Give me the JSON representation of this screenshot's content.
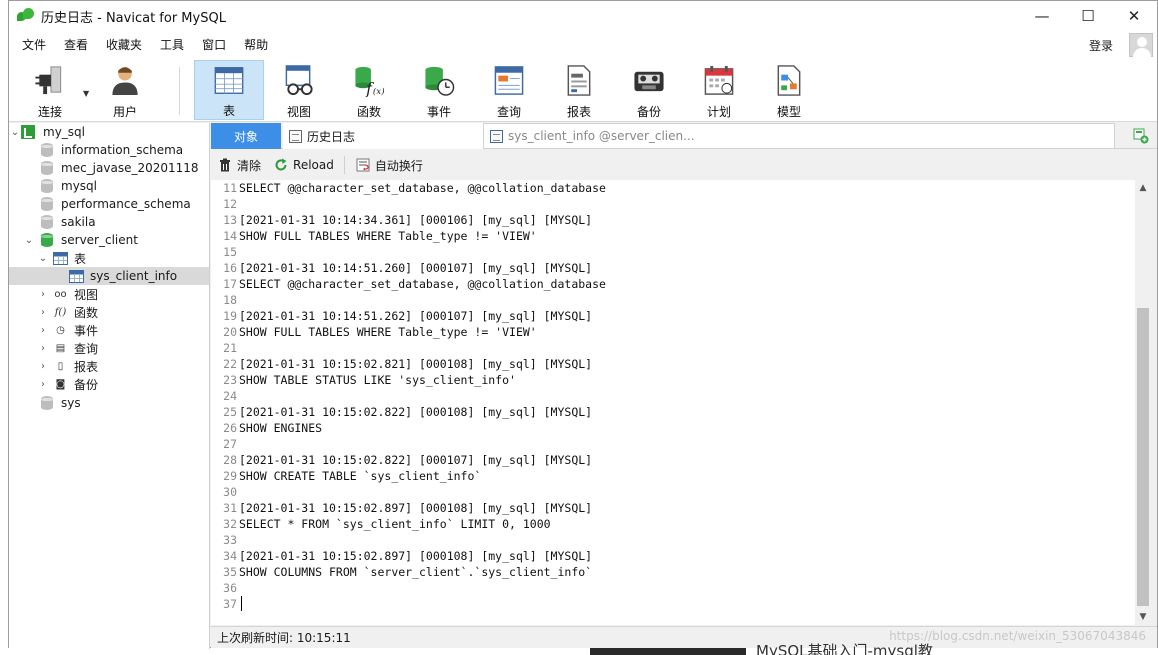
{
  "window": {
    "title": "历史日志 - Navicat for MySQL",
    "minimize_glyph": "—",
    "maximize_glyph": "☐",
    "close_glyph": "✕"
  },
  "menu": {
    "items": [
      "文件",
      "查看",
      "收藏夹",
      "工具",
      "窗口",
      "帮助"
    ],
    "login": "登录"
  },
  "toolbar": {
    "items": [
      {
        "label": "连接",
        "icon": "plug-icon"
      },
      {
        "label": "用户",
        "icon": "user-icon"
      },
      {
        "label": "表",
        "icon": "table-icon",
        "active": true
      },
      {
        "label": "视图",
        "icon": "view-glasses-icon"
      },
      {
        "label": "函数",
        "icon": "function-icon"
      },
      {
        "label": "事件",
        "icon": "event-clock-icon"
      },
      {
        "label": "查询",
        "icon": "query-icon"
      },
      {
        "label": "报表",
        "icon": "report-icon"
      },
      {
        "label": "备份",
        "icon": "backup-icon"
      },
      {
        "label": "计划",
        "icon": "calendar-icon"
      },
      {
        "label": "模型",
        "icon": "model-icon"
      }
    ]
  },
  "sidebar": {
    "connection": "my_sql",
    "databases": [
      "information_schema",
      "mec_javase_20201118",
      "mysql",
      "performance_schema",
      "sakila"
    ],
    "open_db": "server_client",
    "tables_node": "表",
    "selected_table": "sys_client_info",
    "nodes": [
      "视图",
      "函数",
      "事件",
      "查询",
      "报表",
      "备份"
    ],
    "last_db": "sys"
  },
  "tabs": {
    "objects": "对象",
    "history": "历史日志",
    "query": "sys_client_info @server_clien..."
  },
  "subtoolbar": {
    "clear": "清除",
    "reload": "Reload",
    "wrap": "自动换行"
  },
  "editor": {
    "lines": [
      {
        "n": "11",
        "text": "SELECT @@character_set_database, @@collation_database"
      },
      {
        "n": "12",
        "text": ""
      },
      {
        "n": "13",
        "text": "[2021-01-31 10:14:34.361] [000106] [my_sql] [MYSQL]"
      },
      {
        "n": "14",
        "text": "SHOW FULL TABLES WHERE Table_type != 'VIEW'"
      },
      {
        "n": "15",
        "text": ""
      },
      {
        "n": "16",
        "text": "[2021-01-31 10:14:51.260] [000107] [my_sql] [MYSQL]"
      },
      {
        "n": "17",
        "text": "SELECT @@character_set_database, @@collation_database"
      },
      {
        "n": "18",
        "text": ""
      },
      {
        "n": "19",
        "text": "[2021-01-31 10:14:51.262] [000107] [my_sql] [MYSQL]"
      },
      {
        "n": "20",
        "text": "SHOW FULL TABLES WHERE Table_type != 'VIEW'"
      },
      {
        "n": "21",
        "text": ""
      },
      {
        "n": "22",
        "text": "[2021-01-31 10:15:02.821] [000108] [my_sql] [MYSQL]"
      },
      {
        "n": "23",
        "text": "SHOW TABLE STATUS LIKE 'sys_client_info'"
      },
      {
        "n": "24",
        "text": ""
      },
      {
        "n": "25",
        "text": "[2021-01-31 10:15:02.822] [000108] [my_sql] [MYSQL]"
      },
      {
        "n": "26",
        "text": "SHOW ENGINES"
      },
      {
        "n": "27",
        "text": ""
      },
      {
        "n": "28",
        "text": "[2021-01-31 10:15:02.822] [000107] [my_sql] [MYSQL]"
      },
      {
        "n": "29",
        "text": "SHOW CREATE TABLE `sys_client_info`"
      },
      {
        "n": "30",
        "text": ""
      },
      {
        "n": "31",
        "text": "[2021-01-31 10:15:02.897] [000108] [my_sql] [MYSQL]"
      },
      {
        "n": "32",
        "text": "SELECT * FROM `sys_client_info` LIMIT 0, 1000"
      },
      {
        "n": "33",
        "text": ""
      },
      {
        "n": "34",
        "text": "[2021-01-31 10:15:02.897] [000108] [my_sql] [MYSQL]"
      },
      {
        "n": "35",
        "text": "SHOW COLUMNS FROM `server_client`.`sys_client_info`"
      },
      {
        "n": "36",
        "text": ""
      },
      {
        "n": "37",
        "text": ""
      }
    ]
  },
  "statusbar": {
    "text": "上次刷新时间: 10:15:11"
  },
  "background": {
    "link_text": "MySQL基础入门-mysql教",
    "watermark": "https://blog.csdn.net/weixin_53067043846"
  }
}
